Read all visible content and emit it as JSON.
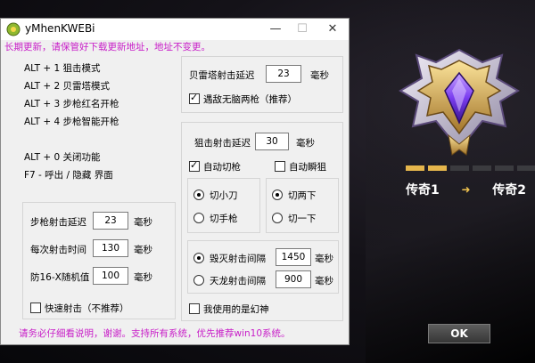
{
  "window": {
    "title": "yMhenKWEBi",
    "minimize": "—",
    "maximize": "☐",
    "close": "✕",
    "notice_top": "长期更新，请保管好下载更新地址，地址不变更。",
    "notice_bottom": "请务必仔细看说明，谢谢。支持所有系统，优先推荐win10系统。"
  },
  "hotkeys": [
    "ALT + 1 狙击模式",
    "ALT + 2 贝雷塔模式",
    "ALT + 3 步枪红名开枪",
    "ALT + 4 步枪智能开枪",
    "ALT + 0 关闭功能",
    "F7 - 呼出 / 隐藏 界面"
  ],
  "rifle": {
    "delay_label": "步枪射击延迟",
    "delay_value": "23",
    "delay_unit": "毫秒",
    "time_label": "每次射击时间",
    "time_value": "130",
    "time_unit": "毫秒",
    "random_label": "防16-X随机值",
    "random_value": "100",
    "random_unit": "毫秒",
    "quick_label": "快速射击（不推荐）"
  },
  "beretta": {
    "delay_label": "贝雷塔射击延迟",
    "delay_value": "23",
    "delay_unit": "毫秒",
    "double_label": "遇敌无脑两枪（推荐）"
  },
  "sniper": {
    "delay_label": "狙击射击延迟",
    "delay_value": "30",
    "delay_unit": "毫秒",
    "auto_switch_label": "自动切枪",
    "auto_instant_label": "自动瞬狙",
    "knife_label": "切小刀",
    "pistol_label": "切手枪",
    "switch_two_label": "切两下",
    "switch_one_label": "切一下",
    "destroy_label": "毁灭射击间隔",
    "destroy_value": "1450",
    "destroy_unit": "毫秒",
    "dragon_label": "天龙射击间隔",
    "dragon_value": "900",
    "dragon_unit": "毫秒",
    "phantom_label": "我使用的是幻神"
  },
  "rank": {
    "from": "传奇1",
    "to": "传奇2",
    "arrow": "➜",
    "progress_filled": 2,
    "progress_total": 6,
    "ok_label": "OK"
  },
  "colors": {
    "notice": "#c81ec8",
    "rank_bar_on": "#e5b64c",
    "badge_gem": "#7a3cf0"
  }
}
